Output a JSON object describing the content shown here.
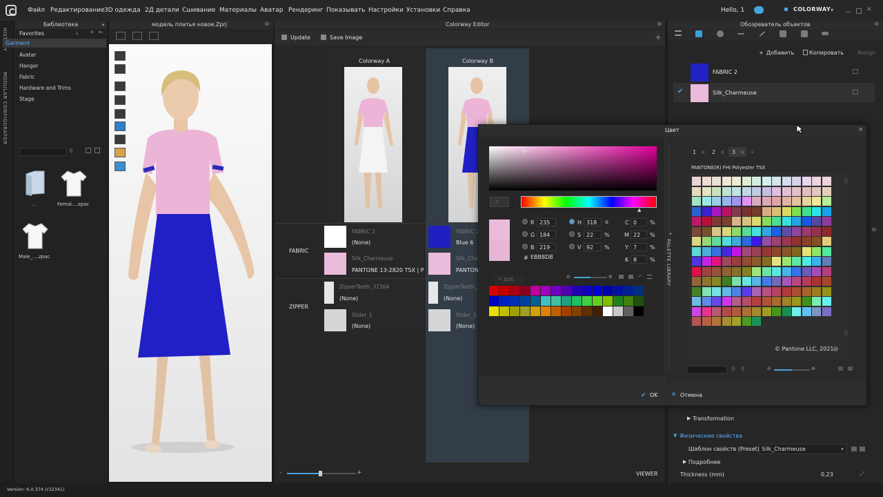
{
  "menubar": {
    "items": [
      "Файл",
      "Редактирование",
      "3D одежда",
      "2Д детали",
      "Сшивание",
      "Материалы",
      "Аватар",
      "Рендеринг",
      "Показывать",
      "Настройки",
      "Установки",
      "Справка"
    ],
    "greeting": "Hello, 1",
    "colorway_button": "COLORWAY"
  },
  "left_strip": {
    "tabs": [
      "HISTORY",
      "MODULAR CONFIGURATOR"
    ]
  },
  "library": {
    "title": "Библиотека",
    "favorites": "Favorites",
    "items": [
      "Garment",
      "Avatar",
      "Hanger",
      "Fabric",
      "Hardware and Trims",
      "Stage"
    ],
    "selected": "Garment",
    "files": [
      {
        "name": "..",
        "icon": "folder-icon"
      },
      {
        "name": "Femal....zpac",
        "icon": "tshirt-icon"
      },
      {
        "name": "Male_....zpac",
        "icon": "tshirt-icon"
      }
    ]
  },
  "viewport": {
    "file_title": "модель платья новое.Zprj"
  },
  "colorway_editor": {
    "title": "Colorway Editor",
    "update_label": "Update",
    "save_image_label": "Save Image",
    "colorways": [
      "Colorway A",
      "Colorway B"
    ],
    "rows": {
      "fabric_label": "FABRIC",
      "zipper_label": "ZIPPER"
    },
    "a": {
      "fabric2_name": "FABRIC 2",
      "fabric2_val": "(None)",
      "silk_name": "Silk_Charmeuse",
      "silk_val": "PANTONE 13-2820 TSX | Pa",
      "zt_name": "ZipperTeeth_31564",
      "zt_val": "(None)",
      "slider_name": "Slider_1",
      "slider_val": "(None)"
    },
    "b": {
      "fabric2_name": "FABRIC 2",
      "fabric2_val": "Blue 6",
      "silk_name": "Silk_Charmeuse",
      "silk_val": "PANTON",
      "zt_name": "ZipperTeeth_31564",
      "zt_val": "(None)",
      "slider_name": "Slider_1",
      "slider_val": "(None)"
    },
    "viewer_label": "VIEWER"
  },
  "object_browser": {
    "title": "Обозреватель объектов",
    "add_label": "Добавить",
    "copy_label": "Копировать",
    "assign_label": "Assign",
    "fabrics": [
      {
        "name": "FABRIC 2",
        "color": "#2222c4"
      },
      {
        "name": "Silk_Charmeuse",
        "color": "#ebbbdb"
      }
    ],
    "transformation_label": "Transformation",
    "physical_label": "Физические свойства",
    "preset_label": "Шаблон свойств (Preset)",
    "preset_value": "Silk_Charmeuse",
    "detail_label": "Подробнее",
    "thickness_label": "Thickness (mm)",
    "thickness_value": "0,23"
  },
  "color_dialog": {
    "title": "Цвет",
    "r": "235",
    "g": "184",
    "b": "219",
    "h": "318",
    "s": "22",
    "v": "92",
    "c": "0",
    "m": "22",
    "y": "7",
    "k": "8",
    "hex": "EBB8DB",
    "labels": {
      "r": "R",
      "g": "G",
      "b": "B",
      "h": "H",
      "s": "S",
      "v": "V",
      "c": "C",
      "m": "M",
      "y": "Y",
      "k": "K",
      "hash": "#",
      "deg": "o",
      "pct": "%"
    },
    "add_label": "Доб.",
    "library_side_label": "PALETTE LIBRARY",
    "library_tabs": [
      "1",
      "2",
      "3"
    ],
    "pantone_title": "PANTONE(R) FHI Polyester TSX",
    "copyright": "© Pantone LLC, 2021",
    "ok_label": "OK",
    "cancel_label": "Отмена",
    "current_color": "#ebbbdb",
    "previous_color": "#e7b5d6"
  },
  "status": {
    "version": "Version: 6.0.374 (r32341)"
  }
}
